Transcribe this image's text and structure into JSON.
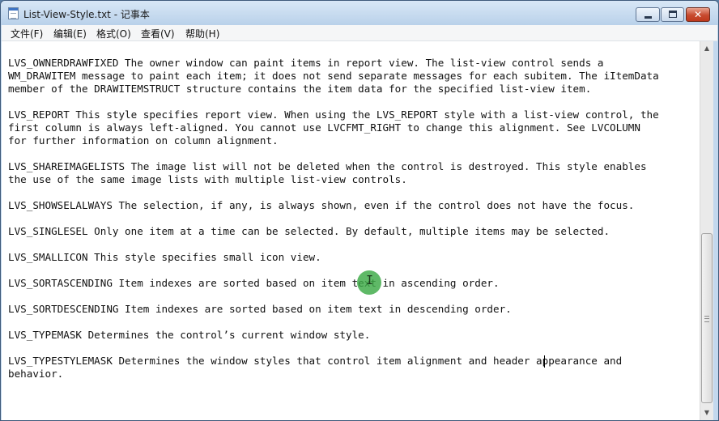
{
  "window": {
    "title": "List-View-Style.txt - 记事本",
    "close_glyph": "✕"
  },
  "menubar": {
    "items": [
      {
        "label": "文件(F)"
      },
      {
        "label": "编辑(E)"
      },
      {
        "label": "格式(O)"
      },
      {
        "label": "查看(V)"
      },
      {
        "label": "帮助(H)"
      }
    ]
  },
  "editor": {
    "content": "LVS_OWNERDRAWFIXED The owner window can paint items in report view. The list-view control sends a\nWM_DRAWITEM message to paint each item; it does not send separate messages for each subitem. The iItemData\nmember of the DRAWITEMSTRUCT structure contains the item data for the specified list-view item.\n\nLVS_REPORT This style specifies report view. When using the LVS_REPORT style with a list-view control, the\nfirst column is always left-aligned. You cannot use LVCFMT_RIGHT to change this alignment. See LVCOLUMN\nfor further information on column alignment.\n\nLVS_SHAREIMAGELISTS The image list will not be deleted when the control is destroyed. This style enables\nthe use of the same image lists with multiple list-view controls.\n\nLVS_SHOWSELALWAYS The selection, if any, is always shown, even if the control does not have the focus.\n\nLVS_SINGLESEL Only one item at a time can be selected. By default, multiple items may be selected.\n\nLVS_SMALLICON This style specifies small icon view.\n\nLVS_SORTASCENDING Item indexes are sorted based on item text in ascending order.\n\nLVS_SORTDESCENDING Item indexes are sorted based on item text in descending order.\n\nLVS_TYPEMASK Determines the control’s current window style.\n\nLVS_TYPESTYLEMASK Determines the window styles that control item alignment and header appearance and\nbehavior."
  },
  "scrollbar": {
    "up_glyph": "▲",
    "down_glyph": "▼"
  },
  "cursor": {
    "ibeam_glyph": "I"
  }
}
